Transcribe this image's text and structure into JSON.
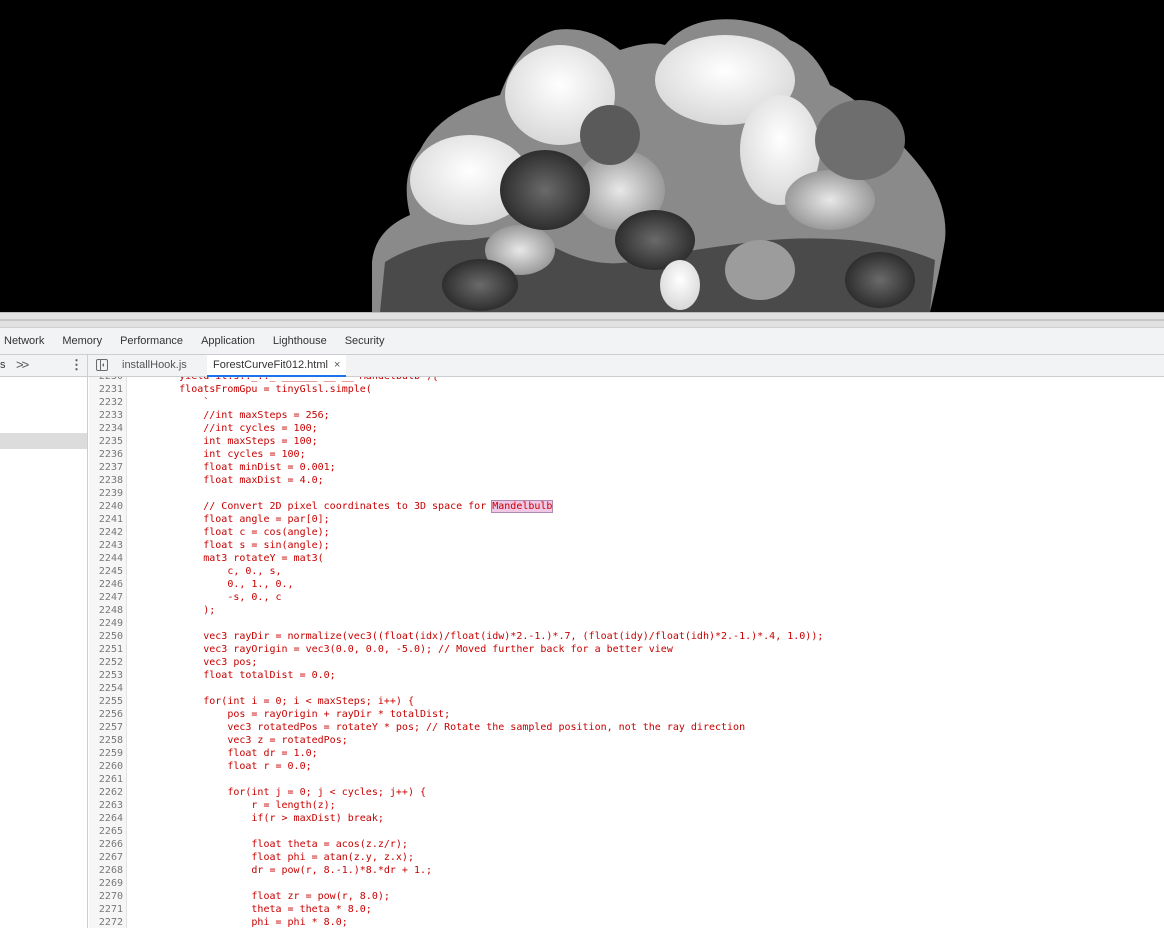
{
  "devtools": {
    "main_tabs": [
      "Network",
      "Memory",
      "Performance",
      "Application",
      "Lighthouse",
      "Security"
    ]
  },
  "sources": {
    "navigator": {
      "truncated_label": "s",
      "more_label": ">>",
      "kebab_label": "⋮"
    },
    "file_tabs": [
      {
        "label": "installHook.js",
        "active": false
      },
      {
        "label": "ForestCurveFit012.html",
        "active": true
      }
    ],
    "close_glyph": "×",
    "highlight_word": "Mandelbulb",
    "code_lines": [
      {
        "n": "2230",
        "t": "        yield it.s.._.._ ______ __ __'Mandelbulb'){"
      },
      {
        "n": "2231",
        "t": "        floatsFromGpu = tinyGlsl.simple("
      },
      {
        "n": "2232",
        "t": "            `"
      },
      {
        "n": "2233",
        "t": "            //int maxSteps = 256;"
      },
      {
        "n": "2234",
        "t": "            //int cycles = 100;"
      },
      {
        "n": "2235",
        "t": "            int maxSteps = 100;"
      },
      {
        "n": "2236",
        "t": "            int cycles = 100;"
      },
      {
        "n": "2237",
        "t": "            float minDist = 0.001;"
      },
      {
        "n": "2238",
        "t": "            float maxDist = 4.0;"
      },
      {
        "n": "2239",
        "t": ""
      },
      {
        "n": "2240",
        "t": "            // Convert 2D pixel coordinates to 3D space for ",
        "hl": "Mandelbulb"
      },
      {
        "n": "2241",
        "t": "            float angle = par[0];"
      },
      {
        "n": "2242",
        "t": "            float c = cos(angle);"
      },
      {
        "n": "2243",
        "t": "            float s = sin(angle);"
      },
      {
        "n": "2244",
        "t": "            mat3 rotateY = mat3("
      },
      {
        "n": "2245",
        "t": "                c, 0., s,"
      },
      {
        "n": "2246",
        "t": "                0., 1., 0.,"
      },
      {
        "n": "2247",
        "t": "                -s, 0., c"
      },
      {
        "n": "2248",
        "t": "            );"
      },
      {
        "n": "2249",
        "t": ""
      },
      {
        "n": "2250",
        "t": "            vec3 rayDir = normalize(vec3((float(idx)/float(idw)*2.-1.)*.7, (float(idy)/float(idh)*2.-1.)*.4, 1.0));"
      },
      {
        "n": "2251",
        "t": "            vec3 rayOrigin = vec3(0.0, 0.0, -5.0); // Moved further back for a better view"
      },
      {
        "n": "2252",
        "t": "            vec3 pos;"
      },
      {
        "n": "2253",
        "t": "            float totalDist = 0.0;"
      },
      {
        "n": "2254",
        "t": ""
      },
      {
        "n": "2255",
        "t": "            for(int i = 0; i < maxSteps; i++) {"
      },
      {
        "n": "2256",
        "t": "                pos = rayOrigin + rayDir * totalDist;"
      },
      {
        "n": "2257",
        "t": "                vec3 rotatedPos = rotateY * pos; // Rotate the sampled position, not the ray direction"
      },
      {
        "n": "2258",
        "t": "                vec3 z = rotatedPos;"
      },
      {
        "n": "2259",
        "t": "                float dr = 1.0;"
      },
      {
        "n": "2260",
        "t": "                float r = 0.0;"
      },
      {
        "n": "2261",
        "t": ""
      },
      {
        "n": "2262",
        "t": "                for(int j = 0; j < cycles; j++) {"
      },
      {
        "n": "2263",
        "t": "                    r = length(z);"
      },
      {
        "n": "2264",
        "t": "                    if(r > maxDist) break;"
      },
      {
        "n": "2265",
        "t": ""
      },
      {
        "n": "2266",
        "t": "                    float theta = acos(z.z/r);"
      },
      {
        "n": "2267",
        "t": "                    float phi = atan(z.y, z.x);"
      },
      {
        "n": "2268",
        "t": "                    dr = pow(r, 8.-1.)*8.*dr + 1.;"
      },
      {
        "n": "2269",
        "t": ""
      },
      {
        "n": "2270",
        "t": "                    float zr = pow(r, 8.0);"
      },
      {
        "n": "2271",
        "t": "                    theta = theta * 8.0;"
      },
      {
        "n": "2272",
        "t": "                    phi = phi * 8.0;"
      }
    ]
  },
  "colors": {
    "code_text": "#c80000",
    "line_number": "#777777",
    "active_tab_underline": "#1a73e8",
    "canvas_background": "#000000",
    "search_highlight": "#f0c8e6"
  },
  "icons": {
    "panel_toggle": "sidebar-toggle-icon",
    "more_tabs": "chevron-double-right-icon",
    "menu": "kebab-menu-icon",
    "close_tab": "close-icon"
  }
}
